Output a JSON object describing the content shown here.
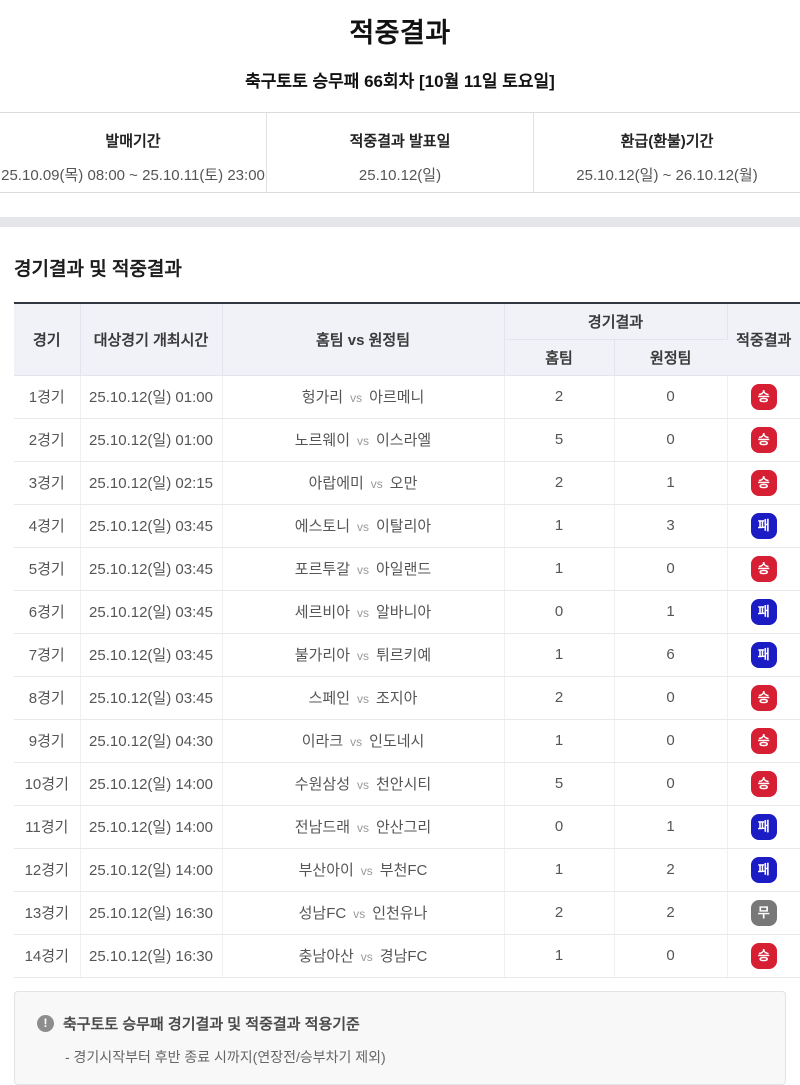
{
  "page": {
    "title": "적중결과",
    "subtitle": "축구토토 승무패 66회차 [10월 11일 토요일]"
  },
  "info": {
    "items": [
      {
        "label": "발매기간",
        "value": "25.10.09(목) 08:00 ~ 25.10.11(토) 23:00"
      },
      {
        "label": "적중결과 발표일",
        "value": "25.10.12(일)"
      },
      {
        "label": "환급(환불)기간",
        "value": "25.10.12(일) ~ 26.10.12(월)"
      }
    ]
  },
  "section": {
    "title": "경기결과 및 적중결과"
  },
  "table": {
    "headers": {
      "match": "경기",
      "time": "대상경기 개최시간",
      "teams": "홈팀 vs 원정팀",
      "result_group": "경기결과",
      "home": "홈팀",
      "away": "원정팀",
      "hit": "적중결과"
    },
    "vs_label": "vs",
    "rows": [
      {
        "match": "1경기",
        "time": "25.10.12(일) 01:00",
        "home_team": "헝가리",
        "away_team": "아르메니",
        "home_score": "2",
        "away_score": "0",
        "result": "승",
        "result_type": "win"
      },
      {
        "match": "2경기",
        "time": "25.10.12(일) 01:00",
        "home_team": "노르웨이",
        "away_team": "이스라엘",
        "home_score": "5",
        "away_score": "0",
        "result": "승",
        "result_type": "win"
      },
      {
        "match": "3경기",
        "time": "25.10.12(일) 02:15",
        "home_team": "아랍에미",
        "away_team": "오만",
        "home_score": "2",
        "away_score": "1",
        "result": "승",
        "result_type": "win"
      },
      {
        "match": "4경기",
        "time": "25.10.12(일) 03:45",
        "home_team": "에스토니",
        "away_team": "이탈리아",
        "home_score": "1",
        "away_score": "3",
        "result": "패",
        "result_type": "lose"
      },
      {
        "match": "5경기",
        "time": "25.10.12(일) 03:45",
        "home_team": "포르투갈",
        "away_team": "아일랜드",
        "home_score": "1",
        "away_score": "0",
        "result": "승",
        "result_type": "win"
      },
      {
        "match": "6경기",
        "time": "25.10.12(일) 03:45",
        "home_team": "세르비아",
        "away_team": "알바니아",
        "home_score": "0",
        "away_score": "1",
        "result": "패",
        "result_type": "lose"
      },
      {
        "match": "7경기",
        "time": "25.10.12(일) 03:45",
        "home_team": "불가리아",
        "away_team": "튀르키예",
        "home_score": "1",
        "away_score": "6",
        "result": "패",
        "result_type": "lose"
      },
      {
        "match": "8경기",
        "time": "25.10.12(일) 03:45",
        "home_team": "스페인",
        "away_team": "조지아",
        "home_score": "2",
        "away_score": "0",
        "result": "승",
        "result_type": "win"
      },
      {
        "match": "9경기",
        "time": "25.10.12(일) 04:30",
        "home_team": "이라크",
        "away_team": "인도네시",
        "home_score": "1",
        "away_score": "0",
        "result": "승",
        "result_type": "win"
      },
      {
        "match": "10경기",
        "time": "25.10.12(일) 14:00",
        "home_team": "수원삼성",
        "away_team": "천안시티",
        "home_score": "5",
        "away_score": "0",
        "result": "승",
        "result_type": "win"
      },
      {
        "match": "11경기",
        "time": "25.10.12(일) 14:00",
        "home_team": "전남드래",
        "away_team": "안산그리",
        "home_score": "0",
        "away_score": "1",
        "result": "패",
        "result_type": "lose"
      },
      {
        "match": "12경기",
        "time": "25.10.12(일) 14:00",
        "home_team": "부산아이",
        "away_team": "부천FC",
        "home_score": "1",
        "away_score": "2",
        "result": "패",
        "result_type": "lose"
      },
      {
        "match": "13경기",
        "time": "25.10.12(일) 16:30",
        "home_team": "성남FC",
        "away_team": "인천유나",
        "home_score": "2",
        "away_score": "2",
        "result": "무",
        "result_type": "draw"
      },
      {
        "match": "14경기",
        "time": "25.10.12(일) 16:30",
        "home_team": "충남아산",
        "away_team": "경남FC",
        "home_score": "1",
        "away_score": "0",
        "result": "승",
        "result_type": "win"
      }
    ]
  },
  "footer": {
    "icon": "exclamation-circle-icon",
    "icon_glyph": "!",
    "title": "축구토토 승무패 경기결과 및 적중결과 적용기준",
    "note": "- 경기시작부터 후반 종료 시까지(연장전/승부차기 제외)"
  },
  "colors": {
    "badge_win": "#d61f33",
    "badge_lose": "#1c1cc4",
    "badge_draw": "#787878",
    "table_header_bg": "#f1f2f8",
    "table_top_border": "#333744",
    "divider_band": "#e4e6ea"
  }
}
